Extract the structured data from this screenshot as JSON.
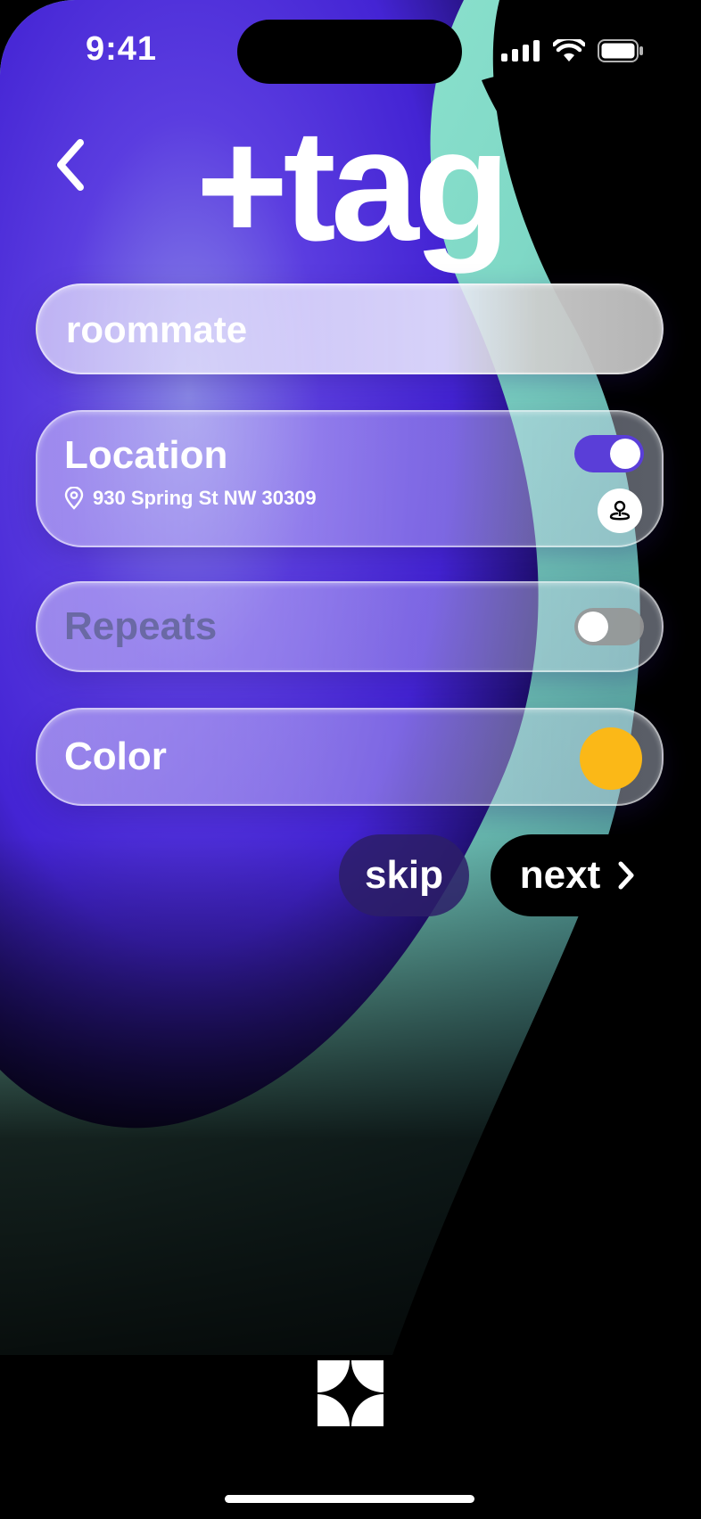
{
  "status_bar": {
    "time": "9:41"
  },
  "header": {
    "title": "+tag"
  },
  "tag_name": {
    "value": "roommate",
    "placeholder": ""
  },
  "location": {
    "label": "Location",
    "address": "930 Spring St NW 30309",
    "enabled": true
  },
  "repeats": {
    "label": "Repeats",
    "enabled": false
  },
  "color": {
    "label": "Color",
    "value": "#FBB817"
  },
  "actions": {
    "skip_label": "skip",
    "next_label": "next"
  },
  "colors": {
    "accent": "#5A3ED8",
    "swatch": "#FBB817",
    "mint": "#7FE3C6"
  }
}
